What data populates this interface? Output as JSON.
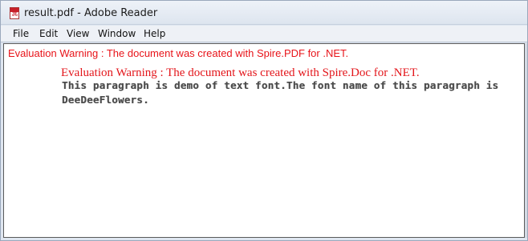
{
  "window": {
    "title": "result.pdf - Adobe Reader",
    "icon": "pdf-file-icon"
  },
  "menu": {
    "items": [
      "File",
      "Edit",
      "View",
      "Window",
      "Help"
    ]
  },
  "document": {
    "warning_pdf": "Evaluation Warning : The document was created with Spire.PDF for .NET.",
    "warning_doc": "Evaluation Warning : The document was created with Spire.Doc for .NET.",
    "paragraph_line1": "This paragraph is demo of text font.The font name of this paragraph is",
    "paragraph_line2": "DeeDeeFlowers."
  },
  "colors": {
    "warning": "#e8141a",
    "paragraph_text": "#4a4a4a"
  }
}
